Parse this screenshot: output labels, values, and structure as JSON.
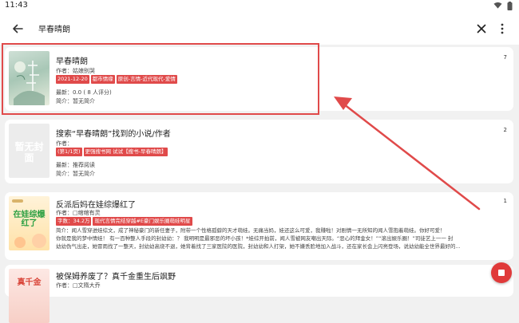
{
  "status": {
    "time": "11:43"
  },
  "search": {
    "query": "早春晴朗"
  },
  "results": [
    {
      "title": "早春晴朗",
      "author": "作者：姑娘别哭",
      "tags": [
        "2021-12-20",
        "都市情缘",
        "原创-言情-近代现代-爱情"
      ],
      "latest": "最新：0.0 ( 8 人评分)",
      "intro": "简介：暂无简介",
      "count": "7",
      "cover_text": "早春晴朗"
    },
    {
      "title": "搜索“早春晴朗”找到的小说/作者",
      "author": "作者：",
      "tags": [
        "(第1/1页)",
        "更强搜书网 试试【搜书-早春晴朗】"
      ],
      "latest": "最新：推荐阅读",
      "intro": "简介：暂无简介",
      "count": "2",
      "cover_text": "暂无封面"
    },
    {
      "title": "反派后妈在娃综爆红了",
      "author": "作者：□绾绾有灵",
      "tags": [
        "字数：34.2万",
        "现代言情完结穿越#E豪门娱乐圈萌娃明星"
      ],
      "intro_lines": [
        "简介：闻人雪穿进娃综文，成了神秘豪门的新任妻子，附带一个性格孤僻的天才萌娃。无痛当妈，娃还这么可爱，我赚啦！对剧情一无所知的闻人雪抱着萌娃。你好可爱！",
        "你就是我的梦中情娃！ 有一百种整人手段的封幼幼：？ 我明明是最邪恶的坏小孩！*娃综开拍前，闻人雪被网友嘲出天际。“恶心的拜金女！”“滚出娱乐圈！”司徒艺上一一 封",
        "幼幼伪气出走，她冒雨找了一整天，封幼幼高烧不退，她背着找了三家医院的医院，封幼幼和人打架，她不嫌丢脸地加入战斗，还在家长会上闪亮登场，说幼幼能全世界最好的..."
      ],
      "count": "1",
      "cover_text": "在娃综爆红了"
    },
    {
      "title": "被保姆养废了？真千金重生后飒野",
      "author": "作者：□文隋大乔",
      "count": "",
      "cover_text": "真千金"
    }
  ],
  "colors": {
    "accent": "#e04a4a",
    "fab": "#e03a3a"
  },
  "icons": {
    "back": "arrow-left-icon",
    "clear": "close-icon",
    "more": "more-vert-icon",
    "fab": "stop-icon"
  }
}
